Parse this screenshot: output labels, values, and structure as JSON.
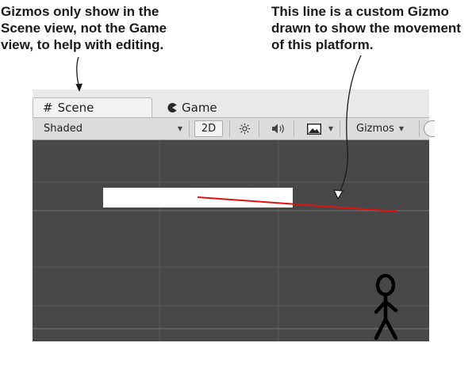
{
  "annotations": {
    "left_callout": [
      "Gizmos only show in the",
      "Scene view, not the Game",
      "view, to help with editing."
    ],
    "right_callout": [
      "This line is a custom Gizmo",
      "drawn to show the movement",
      "of this platform."
    ]
  },
  "tabs": {
    "scene": {
      "label": "Scene",
      "icon": "grid-icon"
    },
    "game": {
      "label": "Game",
      "icon": "pacman-icon"
    }
  },
  "toolbar": {
    "shading_mode": "Shaded",
    "mode_2d_label": "2D",
    "lighting_icon": "sun-icon",
    "audio_icon": "speaker-icon",
    "effects_icon": "image-icon",
    "gizmos_label": "Gizmos"
  },
  "scene": {
    "background_color": "#484848",
    "grid_color": "#5c5c5c",
    "platform_color": "#ffffff",
    "gizmo_line_color": "#e01010",
    "objects": [
      "platform",
      "gizmo-movement-line",
      "stick-figure-player"
    ]
  }
}
